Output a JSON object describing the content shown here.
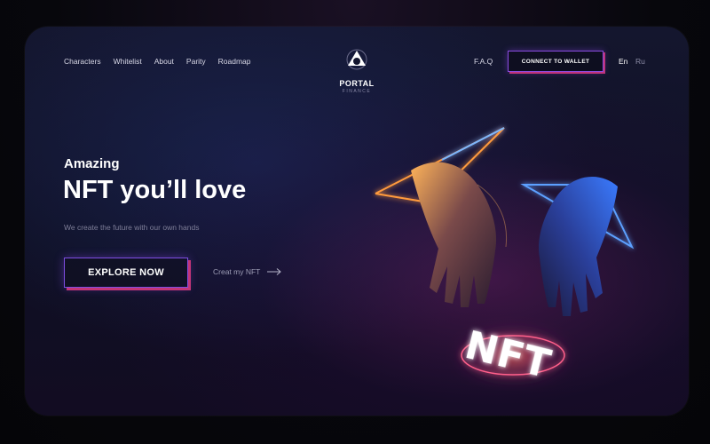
{
  "nav": {
    "links": [
      "Characters",
      "Whitelist",
      "About",
      "Parity",
      "Roadmap"
    ],
    "faq": "F.A.Q",
    "connect_label": "CONNECT TO WALLET",
    "languages": [
      "En",
      "Ru"
    ]
  },
  "logo": {
    "title": "PORTAL",
    "subtitle": "FINANCE"
  },
  "hero": {
    "kicker": "Amazing",
    "title": "NFT you’ll love",
    "subtitle": "We create the future with our own hands",
    "cta_label": "EXPLORE NOW",
    "secondary_label": "Creat my NFT",
    "badge_text": "NFT"
  },
  "icons": {
    "logo": "portal-triangle-icon",
    "arrow": "arrow-right-icon"
  },
  "colors": {
    "accent_purple": "#8a4be0",
    "accent_pink": "#c0337a",
    "glow_orange": "#ff9a3c",
    "glow_blue": "#3c7bff",
    "background": "#0f1024"
  }
}
